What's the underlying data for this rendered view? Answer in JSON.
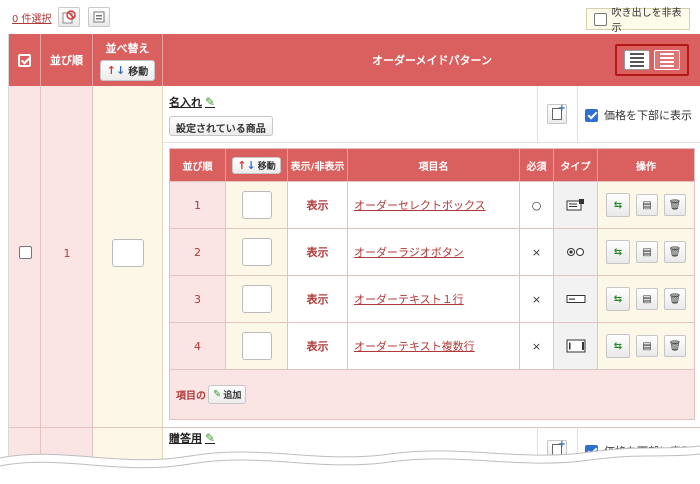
{
  "toolbar": {
    "selected_count": "0 件選択",
    "hide_balloon_label": "吹き出しを非表示"
  },
  "header": {
    "order_label": "並び順",
    "sort_label": "並べ替え",
    "move_label": "移動",
    "pattern_label": "オーダーメイドパターン"
  },
  "groups": [
    {
      "order": "1",
      "title": "名入れ",
      "set_products_label": "設定されている商品",
      "price_below_label": "価格を下部に表示",
      "items_table": {
        "headers": {
          "order": "並び順",
          "move": "移動",
          "visibility": "表示/非表示",
          "name": "項目名",
          "required": "必須",
          "type": "タイプ",
          "actions": "操作"
        },
        "rows": [
          {
            "order": "1",
            "visibility": "表示",
            "name": "オーダーセレクトボックス",
            "required": "○",
            "type_icon": "select-box-icon"
          },
          {
            "order": "2",
            "visibility": "表示",
            "name": "オーダーラジオボタン",
            "required": "×",
            "type_icon": "radio-button-icon"
          },
          {
            "order": "3",
            "visibility": "表示",
            "name": "オーダーテキスト１行",
            "required": "×",
            "type_icon": "text-line-icon"
          },
          {
            "order": "4",
            "visibility": "表示",
            "name": "オーダーテキスト複数行",
            "required": "×",
            "type_icon": "textarea-icon"
          }
        ],
        "add_prefix": "項目の",
        "add_label": "追加"
      }
    },
    {
      "order": "",
      "title": "贈答用",
      "price_below_label": "価格を下部に表示"
    }
  ],
  "colors": {
    "header_red": "#d9605f",
    "pink_bg": "#fbe5e4",
    "cream_bg": "#fcf7e6",
    "accent_text": "#b03a3a",
    "highlight_border": "#b51818"
  }
}
